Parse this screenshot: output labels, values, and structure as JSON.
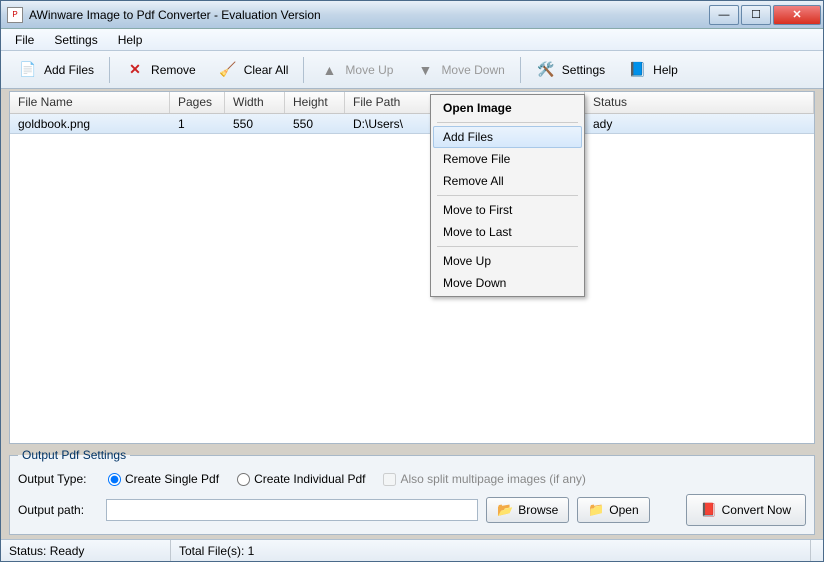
{
  "title": "AWinware Image to Pdf Converter - Evaluation Version",
  "menubar": {
    "file": "File",
    "settings": "Settings",
    "help": "Help"
  },
  "toolbar": {
    "add_files": "Add Files",
    "remove": "Remove",
    "clear_all": "Clear All",
    "move_up": "Move Up",
    "move_down": "Move Down",
    "settings": "Settings",
    "help": "Help"
  },
  "columns": {
    "filename": "File Name",
    "pages": "Pages",
    "width": "Width",
    "height": "Height",
    "path": "File Path",
    "status": "Status"
  },
  "row": {
    "filename": "goldbook.png",
    "pages": "1",
    "width": "550",
    "height": "550",
    "path": "D:\\Users\\",
    "status": "ady"
  },
  "context": {
    "open_image": "Open Image",
    "add_files": "Add Files",
    "remove_file": "Remove File",
    "remove_all": "Remove All",
    "move_first": "Move to First",
    "move_last": "Move to Last",
    "move_up": "Move Up",
    "move_down": "Move Down"
  },
  "output": {
    "legend": "Output Pdf Settings",
    "type_label": "Output Type:",
    "single": "Create Single Pdf",
    "individual": "Create Individual Pdf",
    "split": "Also split multipage images (if any)",
    "path_label": "Output path:",
    "browse": "Browse",
    "open": "Open",
    "convert": "Convert Now"
  },
  "status": {
    "ready": "Status: Ready",
    "total": "Total File(s): 1"
  }
}
